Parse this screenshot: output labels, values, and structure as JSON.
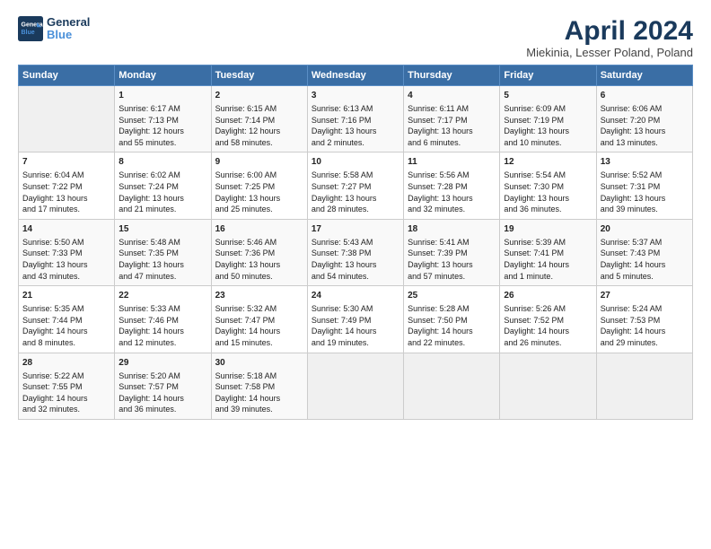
{
  "logo": {
    "line1": "General",
    "line2": "Blue"
  },
  "title": "April 2024",
  "subtitle": "Miekinia, Lesser Poland, Poland",
  "days_of_week": [
    "Sunday",
    "Monday",
    "Tuesday",
    "Wednesday",
    "Thursday",
    "Friday",
    "Saturday"
  ],
  "weeks": [
    [
      {
        "day": "",
        "info": ""
      },
      {
        "day": "1",
        "info": "Sunrise: 6:17 AM\nSunset: 7:13 PM\nDaylight: 12 hours\nand 55 minutes."
      },
      {
        "day": "2",
        "info": "Sunrise: 6:15 AM\nSunset: 7:14 PM\nDaylight: 12 hours\nand 58 minutes."
      },
      {
        "day": "3",
        "info": "Sunrise: 6:13 AM\nSunset: 7:16 PM\nDaylight: 13 hours\nand 2 minutes."
      },
      {
        "day": "4",
        "info": "Sunrise: 6:11 AM\nSunset: 7:17 PM\nDaylight: 13 hours\nand 6 minutes."
      },
      {
        "day": "5",
        "info": "Sunrise: 6:09 AM\nSunset: 7:19 PM\nDaylight: 13 hours\nand 10 minutes."
      },
      {
        "day": "6",
        "info": "Sunrise: 6:06 AM\nSunset: 7:20 PM\nDaylight: 13 hours\nand 13 minutes."
      }
    ],
    [
      {
        "day": "7",
        "info": "Sunrise: 6:04 AM\nSunset: 7:22 PM\nDaylight: 13 hours\nand 17 minutes."
      },
      {
        "day": "8",
        "info": "Sunrise: 6:02 AM\nSunset: 7:24 PM\nDaylight: 13 hours\nand 21 minutes."
      },
      {
        "day": "9",
        "info": "Sunrise: 6:00 AM\nSunset: 7:25 PM\nDaylight: 13 hours\nand 25 minutes."
      },
      {
        "day": "10",
        "info": "Sunrise: 5:58 AM\nSunset: 7:27 PM\nDaylight: 13 hours\nand 28 minutes."
      },
      {
        "day": "11",
        "info": "Sunrise: 5:56 AM\nSunset: 7:28 PM\nDaylight: 13 hours\nand 32 minutes."
      },
      {
        "day": "12",
        "info": "Sunrise: 5:54 AM\nSunset: 7:30 PM\nDaylight: 13 hours\nand 36 minutes."
      },
      {
        "day": "13",
        "info": "Sunrise: 5:52 AM\nSunset: 7:31 PM\nDaylight: 13 hours\nand 39 minutes."
      }
    ],
    [
      {
        "day": "14",
        "info": "Sunrise: 5:50 AM\nSunset: 7:33 PM\nDaylight: 13 hours\nand 43 minutes."
      },
      {
        "day": "15",
        "info": "Sunrise: 5:48 AM\nSunset: 7:35 PM\nDaylight: 13 hours\nand 47 minutes."
      },
      {
        "day": "16",
        "info": "Sunrise: 5:46 AM\nSunset: 7:36 PM\nDaylight: 13 hours\nand 50 minutes."
      },
      {
        "day": "17",
        "info": "Sunrise: 5:43 AM\nSunset: 7:38 PM\nDaylight: 13 hours\nand 54 minutes."
      },
      {
        "day": "18",
        "info": "Sunrise: 5:41 AM\nSunset: 7:39 PM\nDaylight: 13 hours\nand 57 minutes."
      },
      {
        "day": "19",
        "info": "Sunrise: 5:39 AM\nSunset: 7:41 PM\nDaylight: 14 hours\nand 1 minute."
      },
      {
        "day": "20",
        "info": "Sunrise: 5:37 AM\nSunset: 7:43 PM\nDaylight: 14 hours\nand 5 minutes."
      }
    ],
    [
      {
        "day": "21",
        "info": "Sunrise: 5:35 AM\nSunset: 7:44 PM\nDaylight: 14 hours\nand 8 minutes."
      },
      {
        "day": "22",
        "info": "Sunrise: 5:33 AM\nSunset: 7:46 PM\nDaylight: 14 hours\nand 12 minutes."
      },
      {
        "day": "23",
        "info": "Sunrise: 5:32 AM\nSunset: 7:47 PM\nDaylight: 14 hours\nand 15 minutes."
      },
      {
        "day": "24",
        "info": "Sunrise: 5:30 AM\nSunset: 7:49 PM\nDaylight: 14 hours\nand 19 minutes."
      },
      {
        "day": "25",
        "info": "Sunrise: 5:28 AM\nSunset: 7:50 PM\nDaylight: 14 hours\nand 22 minutes."
      },
      {
        "day": "26",
        "info": "Sunrise: 5:26 AM\nSunset: 7:52 PM\nDaylight: 14 hours\nand 26 minutes."
      },
      {
        "day": "27",
        "info": "Sunrise: 5:24 AM\nSunset: 7:53 PM\nDaylight: 14 hours\nand 29 minutes."
      }
    ],
    [
      {
        "day": "28",
        "info": "Sunrise: 5:22 AM\nSunset: 7:55 PM\nDaylight: 14 hours\nand 32 minutes."
      },
      {
        "day": "29",
        "info": "Sunrise: 5:20 AM\nSunset: 7:57 PM\nDaylight: 14 hours\nand 36 minutes."
      },
      {
        "day": "30",
        "info": "Sunrise: 5:18 AM\nSunset: 7:58 PM\nDaylight: 14 hours\nand 39 minutes."
      },
      {
        "day": "",
        "info": ""
      },
      {
        "day": "",
        "info": ""
      },
      {
        "day": "",
        "info": ""
      },
      {
        "day": "",
        "info": ""
      }
    ]
  ]
}
